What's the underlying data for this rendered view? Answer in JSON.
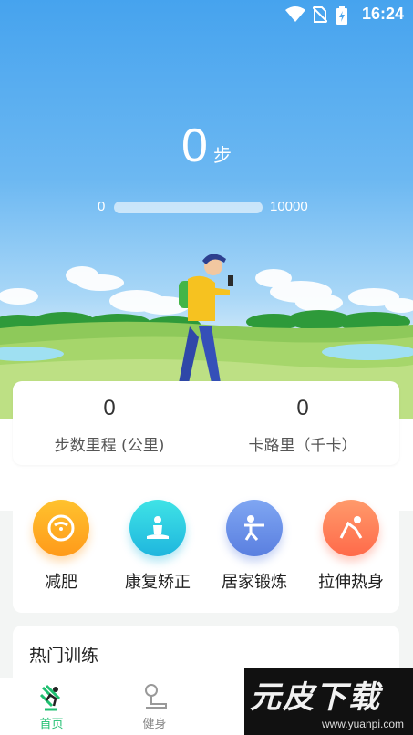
{
  "status_bar": {
    "time": "16:24"
  },
  "steps": {
    "value": "0",
    "unit": "步"
  },
  "progress": {
    "min_label": "0",
    "max_label": "10000",
    "fraction": 0
  },
  "stats": [
    {
      "value": "0",
      "label": "步数里程 (公里)"
    },
    {
      "value": "0",
      "label": "卡路里（千卡）"
    }
  ],
  "categories": [
    {
      "label": "减肥",
      "icon": "scale-icon",
      "color_top": "#ffc22e",
      "color_bottom": "#ff9a1a"
    },
    {
      "label": "康复矫正",
      "icon": "meditation-icon",
      "color_top": "#3fe3e6",
      "color_bottom": "#1fb6de"
    },
    {
      "label": "居家锻炼",
      "icon": "exercise-icon",
      "color_top": "#7fa6f2",
      "color_bottom": "#5a7fe0"
    },
    {
      "label": "拉伸热身",
      "icon": "stretch-icon",
      "color_top": "#ff9a6b",
      "color_bottom": "#ff6a4a"
    }
  ],
  "hot_training": {
    "title": "热门训练"
  },
  "bottom_nav": [
    {
      "label": "首页",
      "icon": "runner-icon",
      "active": true
    },
    {
      "label": "健身",
      "icon": "fitness-icon",
      "active": false
    }
  ],
  "watermark": {
    "big": "元皮下载",
    "url": "www.yuanpi.com"
  },
  "colors": {
    "accent": "#1fbf70",
    "sky": "#46a3ee"
  }
}
